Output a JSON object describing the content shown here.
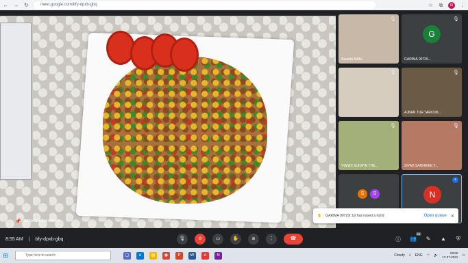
{
  "browser": {
    "url": "meet.google.com/bfy-dpxb-gbq",
    "profile_initial": "G"
  },
  "main_tile": {
    "name": "NYSA CHAEJA MARIO"
  },
  "tiles": [
    {
      "label": "Swarda Sidhu",
      "type": "video",
      "bg": "#c8b8a8"
    },
    {
      "label": "GARIMA 00729...",
      "type": "avatar",
      "initial": "G",
      "color": "#188038"
    },
    {
      "label": "",
      "type": "video",
      "bg": "#d6cdbf"
    },
    {
      "label": "AJNAN TUR TAROOK...",
      "type": "video",
      "bg": "#6b5a44"
    },
    {
      "label": "VIANDI SUHAYE THE...",
      "type": "video",
      "bg": "#a3b07a"
    },
    {
      "label": "SIYAH SAHNIKEE T...",
      "type": "video",
      "bg": "#b57a64"
    },
    {
      "label": "",
      "type": "pair",
      "initials": [
        "S",
        "S"
      ],
      "colors": [
        "#e37400",
        "#a142f4"
      ]
    },
    {
      "label": "",
      "type": "avatar",
      "initial": "N",
      "color": "#d93025"
    }
  ],
  "toast": {
    "message": "GARIMA 00729/ 1st has raised a hand",
    "open_label": "Open queue"
  },
  "controls": {
    "time": "8:55 AM",
    "meeting_code": "bfy-dpxb-gbq",
    "people_count": "28"
  },
  "taskbar": {
    "search_placeholder": "Type here to search",
    "weather": "Cloudy",
    "lang": "ENG",
    "time": "08:55",
    "date": "17-07-2021"
  },
  "colors": {
    "meet_bg": "#202124",
    "end_call": "#ea4335",
    "accent": "#1a73e8"
  }
}
